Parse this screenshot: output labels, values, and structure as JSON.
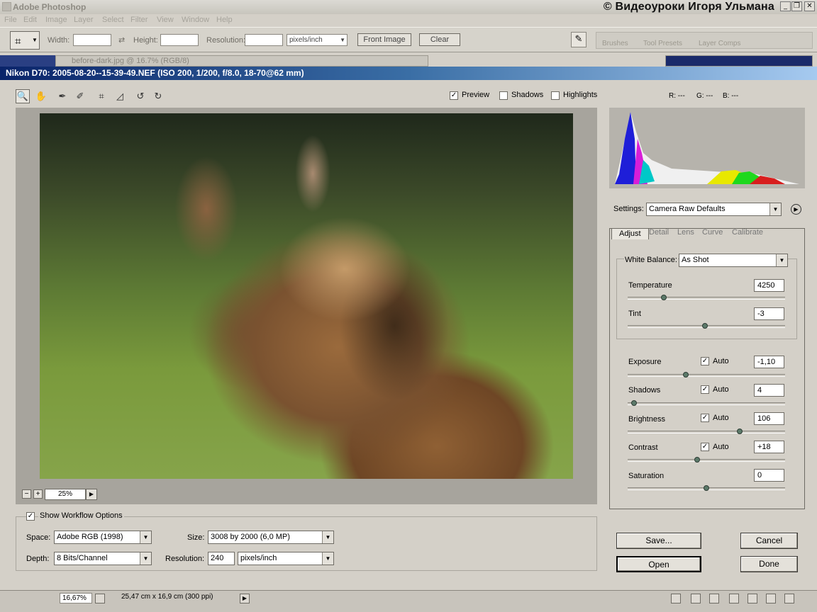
{
  "photoshop": {
    "title": "Adobe Photoshop",
    "watermark": "© Видеоуроки Игоря Ульмана",
    "menu": [
      "File",
      "Edit",
      "Image",
      "Layer",
      "Select",
      "Filter",
      "View",
      "Window",
      "Help"
    ],
    "options": {
      "width_label": "Width:",
      "height_label": "Height:",
      "resolution_label": "Resolution:",
      "units": "pixels/inch",
      "front_image": "Front Image",
      "clear": "Clear"
    },
    "palette_tabs": [
      "Brushes",
      "Tool Presets",
      "Layer Comps"
    ],
    "doc_tab": "before-dark.jpg @ 16.7% (RGB/8)",
    "status_zoom": "16,67%",
    "status_info": "25,47 cm x 16,9 cm (300 ppi)"
  },
  "camera_raw": {
    "title": "Nikon D70:  2005-08-20--15-39-49.NEF  (ISO 200, 1/200, f/8.0, 18-70@62 mm)",
    "preview_label": "Preview",
    "preview_checked": true,
    "shadows_label": "Shadows",
    "highlights_label": "Highlights",
    "rgb": {
      "r": "R: ---",
      "g": "G: ---",
      "b": "B: ---"
    },
    "zoom": "25%",
    "settings_label": "Settings:",
    "settings_value": "Camera Raw Defaults",
    "tabs": [
      "Adjust",
      "Detail",
      "Lens",
      "Curve",
      "Calibrate"
    ],
    "active_tab": "Adjust",
    "white_balance_label": "White Balance:",
    "white_balance_value": "As Shot",
    "auto_label": "Auto",
    "sliders": {
      "temperature": {
        "label": "Temperature",
        "value": "4250",
        "position": 0.23
      },
      "tint": {
        "label": "Tint",
        "value": "-3",
        "position": 0.49
      },
      "exposure": {
        "label": "Exposure",
        "value": "-1,10",
        "position": 0.37
      },
      "shadows": {
        "label": "Shadows",
        "value": "4",
        "position": 0.04
      },
      "brightness": {
        "label": "Brightness",
        "value": "106",
        "position": 0.71
      },
      "contrast": {
        "label": "Contrast",
        "value": "+18",
        "position": 0.44
      },
      "saturation": {
        "label": "Saturation",
        "value": "0",
        "position": 0.5
      }
    },
    "workflow": {
      "show_label": "Show Workflow Options",
      "space_label": "Space:",
      "space_value": "Adobe RGB (1998)",
      "depth_label": "Depth:",
      "depth_value": "8 Bits/Channel",
      "size_label": "Size:",
      "size_value": "3008 by 2000  (6,0 MP)",
      "resolution_label": "Resolution:",
      "resolution_value": "240",
      "resolution_units": "pixels/inch"
    },
    "buttons": {
      "save": "Save...",
      "cancel": "Cancel",
      "open": "Open",
      "done": "Done"
    }
  },
  "colors": {
    "accent_title": "#0a246a",
    "slider_thumb": "#5c7a6a"
  }
}
